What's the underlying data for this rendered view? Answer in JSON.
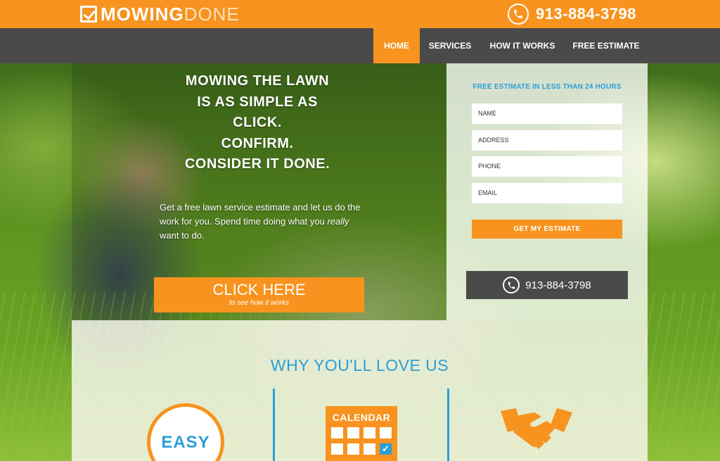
{
  "brand": {
    "name_part1": "MOWING",
    "name_part2": "DONE"
  },
  "phone": "913-884-3798",
  "nav": {
    "items": [
      {
        "label": "HOME",
        "active": true
      },
      {
        "label": "SERVICES",
        "active": false
      },
      {
        "label": "HOW IT WORKS",
        "active": false
      },
      {
        "label": "FREE ESTIMATE",
        "active": false
      }
    ]
  },
  "hero": {
    "headline_lines": [
      "MOWING THE LAWN",
      "IS AS SIMPLE AS",
      "CLICK.",
      "CONFIRM.",
      "CONSIDER IT DONE."
    ],
    "subtext_before": "Get a free lawn service estimate and let us do the work for you. Spend time doing what you ",
    "subtext_emphasis": "really",
    "subtext_after": " want to do.",
    "cta_main": "CLICK HERE",
    "cta_sub": "to see how it works"
  },
  "form": {
    "title": "FREE ESTIMATE IN LESS THAN 24 HOURS",
    "fields": {
      "name": "NAME",
      "address": "ADDRESS",
      "phone": "PHONE",
      "email": "EMAIL"
    },
    "submit_label": "GET MY ESTIMATE"
  },
  "why": {
    "title": "WHY YOU'LL LOVE US",
    "easy_label": "EASY",
    "calendar_label": "CALENDAR"
  },
  "colors": {
    "accent": "#f7931e",
    "blue": "#2a9fd8",
    "dark": "#4a4a4a"
  },
  "icons": [
    "checkbox-logo-icon",
    "phone-icon",
    "calendar-icon",
    "check-icon",
    "handshake-icon"
  ]
}
